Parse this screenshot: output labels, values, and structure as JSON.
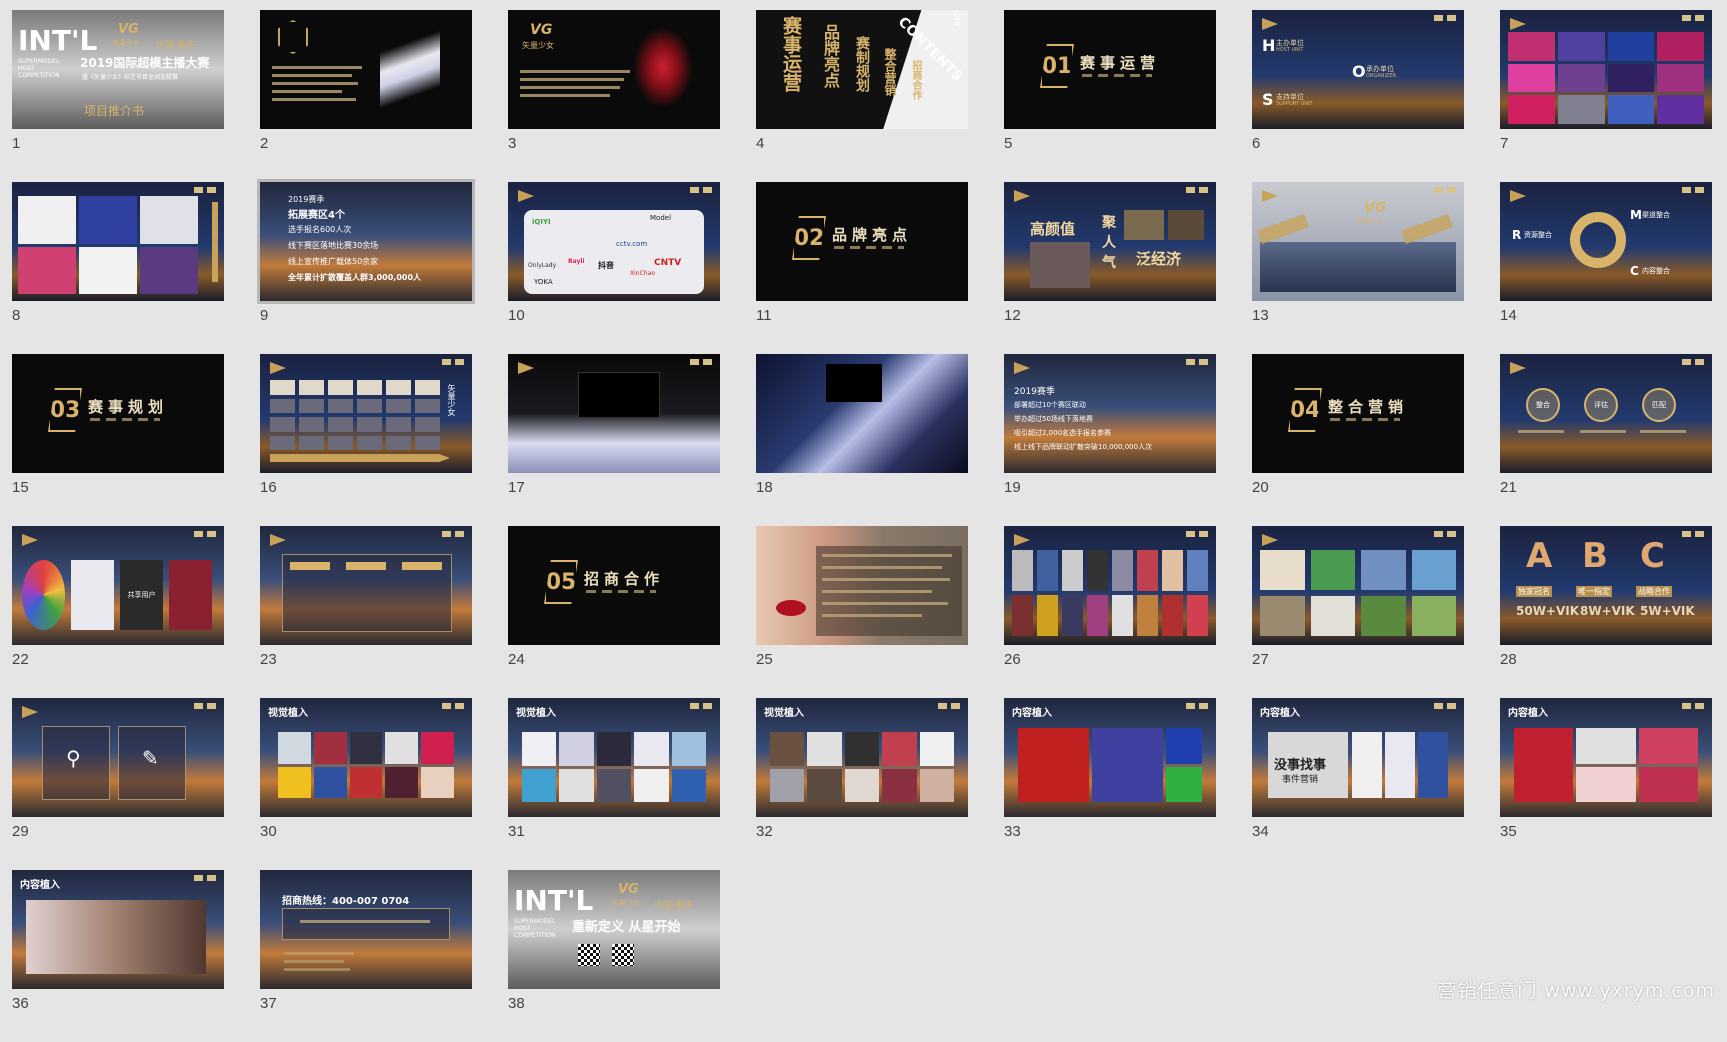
{
  "slides": [
    {
      "n": "1"
    },
    {
      "n": "2"
    },
    {
      "n": "3"
    },
    {
      "n": "4"
    },
    {
      "n": "5"
    },
    {
      "n": "6"
    },
    {
      "n": "7"
    },
    {
      "n": "8"
    },
    {
      "n": "9",
      "selected": true
    },
    {
      "n": "10"
    },
    {
      "n": "11"
    },
    {
      "n": "12"
    },
    {
      "n": "13"
    },
    {
      "n": "14"
    },
    {
      "n": "15"
    },
    {
      "n": "16"
    },
    {
      "n": "17"
    },
    {
      "n": "18"
    },
    {
      "n": "19"
    },
    {
      "n": "20"
    },
    {
      "n": "21"
    },
    {
      "n": "22"
    },
    {
      "n": "23"
    },
    {
      "n": "24"
    },
    {
      "n": "25"
    },
    {
      "n": "26"
    },
    {
      "n": "27"
    },
    {
      "n": "28"
    },
    {
      "n": "29"
    },
    {
      "n": "30"
    },
    {
      "n": "31"
    },
    {
      "n": "32"
    },
    {
      "n": "33"
    },
    {
      "n": "34"
    },
    {
      "n": "35"
    },
    {
      "n": "36"
    },
    {
      "n": "37"
    },
    {
      "n": "38"
    }
  ],
  "s1": {
    "intl": "INT'L",
    "vg": "VG",
    "brand": "矢量少女",
    "city": "中国·重庆",
    "title": "2019国际超模主播大赛",
    "sub": "暨《矢量少女》综艺节目全国选拔赛",
    "tag": "项目推介书",
    "side": "SUPERMODEL HOST COMPETITION"
  },
  "s3": {
    "vg": "VG",
    "brand": "矢量少女"
  },
  "s4": {
    "a": "赛事运营",
    "b": "品牌亮点",
    "c": "赛制规划",
    "d": "整合营销",
    "e": "招商合作",
    "f": "CONTENTS",
    "g": "目录"
  },
  "s5": {
    "num": "01",
    "title": "赛事运营"
  },
  "s6": {
    "h": "H",
    "h_t": "主办单位",
    "h_e": "HOST UNIT",
    "o": "O",
    "o_t": "承办单位",
    "o_e": "ORGANIZER",
    "s": "S",
    "s_t": "支持单位",
    "s_e": "SUPPORT UNIT"
  },
  "s9": {
    "l1": "2019赛季",
    "l2": "拓展赛区4个",
    "l3": "选手报名600人次",
    "l4": "线下赛区落地比赛30余场",
    "l5": "线上宣传推广载体50余家",
    "l6": "全年累计扩散覆盖人群3,000,000人"
  },
  "s10": {
    "m1": "iQIYI",
    "m2": "Model",
    "m3": "抖音",
    "m4": "CNTV",
    "m5": "YOKA",
    "m6": "OnlyLady",
    "m7": "XinChao",
    "m8": "cctv.com",
    "m9": "Rayli"
  },
  "s11": {
    "num": "02",
    "title": "品牌亮点"
  },
  "s12": {
    "a": "高颜值",
    "b": "聚",
    "c": "人",
    "d": "气",
    "e": "泛经济"
  },
  "s13": {
    "vg": "VG",
    "brand": "矢量少女"
  },
  "s14": {
    "m": "M",
    "m_t": "渠道整合",
    "r": "R",
    "r_t": "资源整合",
    "c": "C",
    "c_t": "内容整合"
  },
  "s15": {
    "num": "03",
    "title": "赛事规划"
  },
  "s16": {
    "tag": "矢量少女"
  },
  "s18": {},
  "s19": {
    "l1": "2019赛季",
    "l2": "部署超过10个赛区联动",
    "l3": "举办超过50场线下落地赛",
    "l4": "吸引超过2,000名选手报名参赛",
    "l5": "线上线下品牌联动扩散突破10,000,000人次"
  },
  "s20": {
    "num": "04",
    "title": "整合营销"
  },
  "s21": {
    "a": "整合",
    "b": "评估",
    "c": "匹配"
  },
  "s22": {
    "t": "共享用户"
  },
  "s24": {
    "num": "05",
    "title": "招商合作"
  },
  "s28": {
    "a": "A",
    "b": "B",
    "c": "C",
    "a_t": "独家冠名",
    "b_t": "唯一指定",
    "c_t": "战略合作",
    "a_p": "50W+VIK",
    "b_p": "8W+VIK",
    "c_p": "5W+VIK"
  },
  "s30": {
    "h": "视觉植入"
  },
  "s31": {
    "h": "视觉植入"
  },
  "s32": {
    "h": "视觉植入"
  },
  "s33": {
    "h": "内容植入"
  },
  "s34": {
    "h": "内容植入",
    "t": "没事找事",
    "t2": "事件营销"
  },
  "s35": {
    "h": "内容植入"
  },
  "s36": {
    "h": "内容植入"
  },
  "s37": {
    "hotline": "招商热线：400-007 0704"
  },
  "s38": {
    "intl": "INT'L",
    "vg": "VG",
    "brand": "矢量少女",
    "city": "中国·重庆",
    "slogan": "重新定义 从星开始",
    "side": "SUPERMODEL HOST COMPETITION"
  },
  "watermark": "营销任意门 www.yxrym.com",
  "colors": {
    "accent": "#d8b46a",
    "bg": "#e5e5e5",
    "selected_border": "#b8b8b8"
  }
}
